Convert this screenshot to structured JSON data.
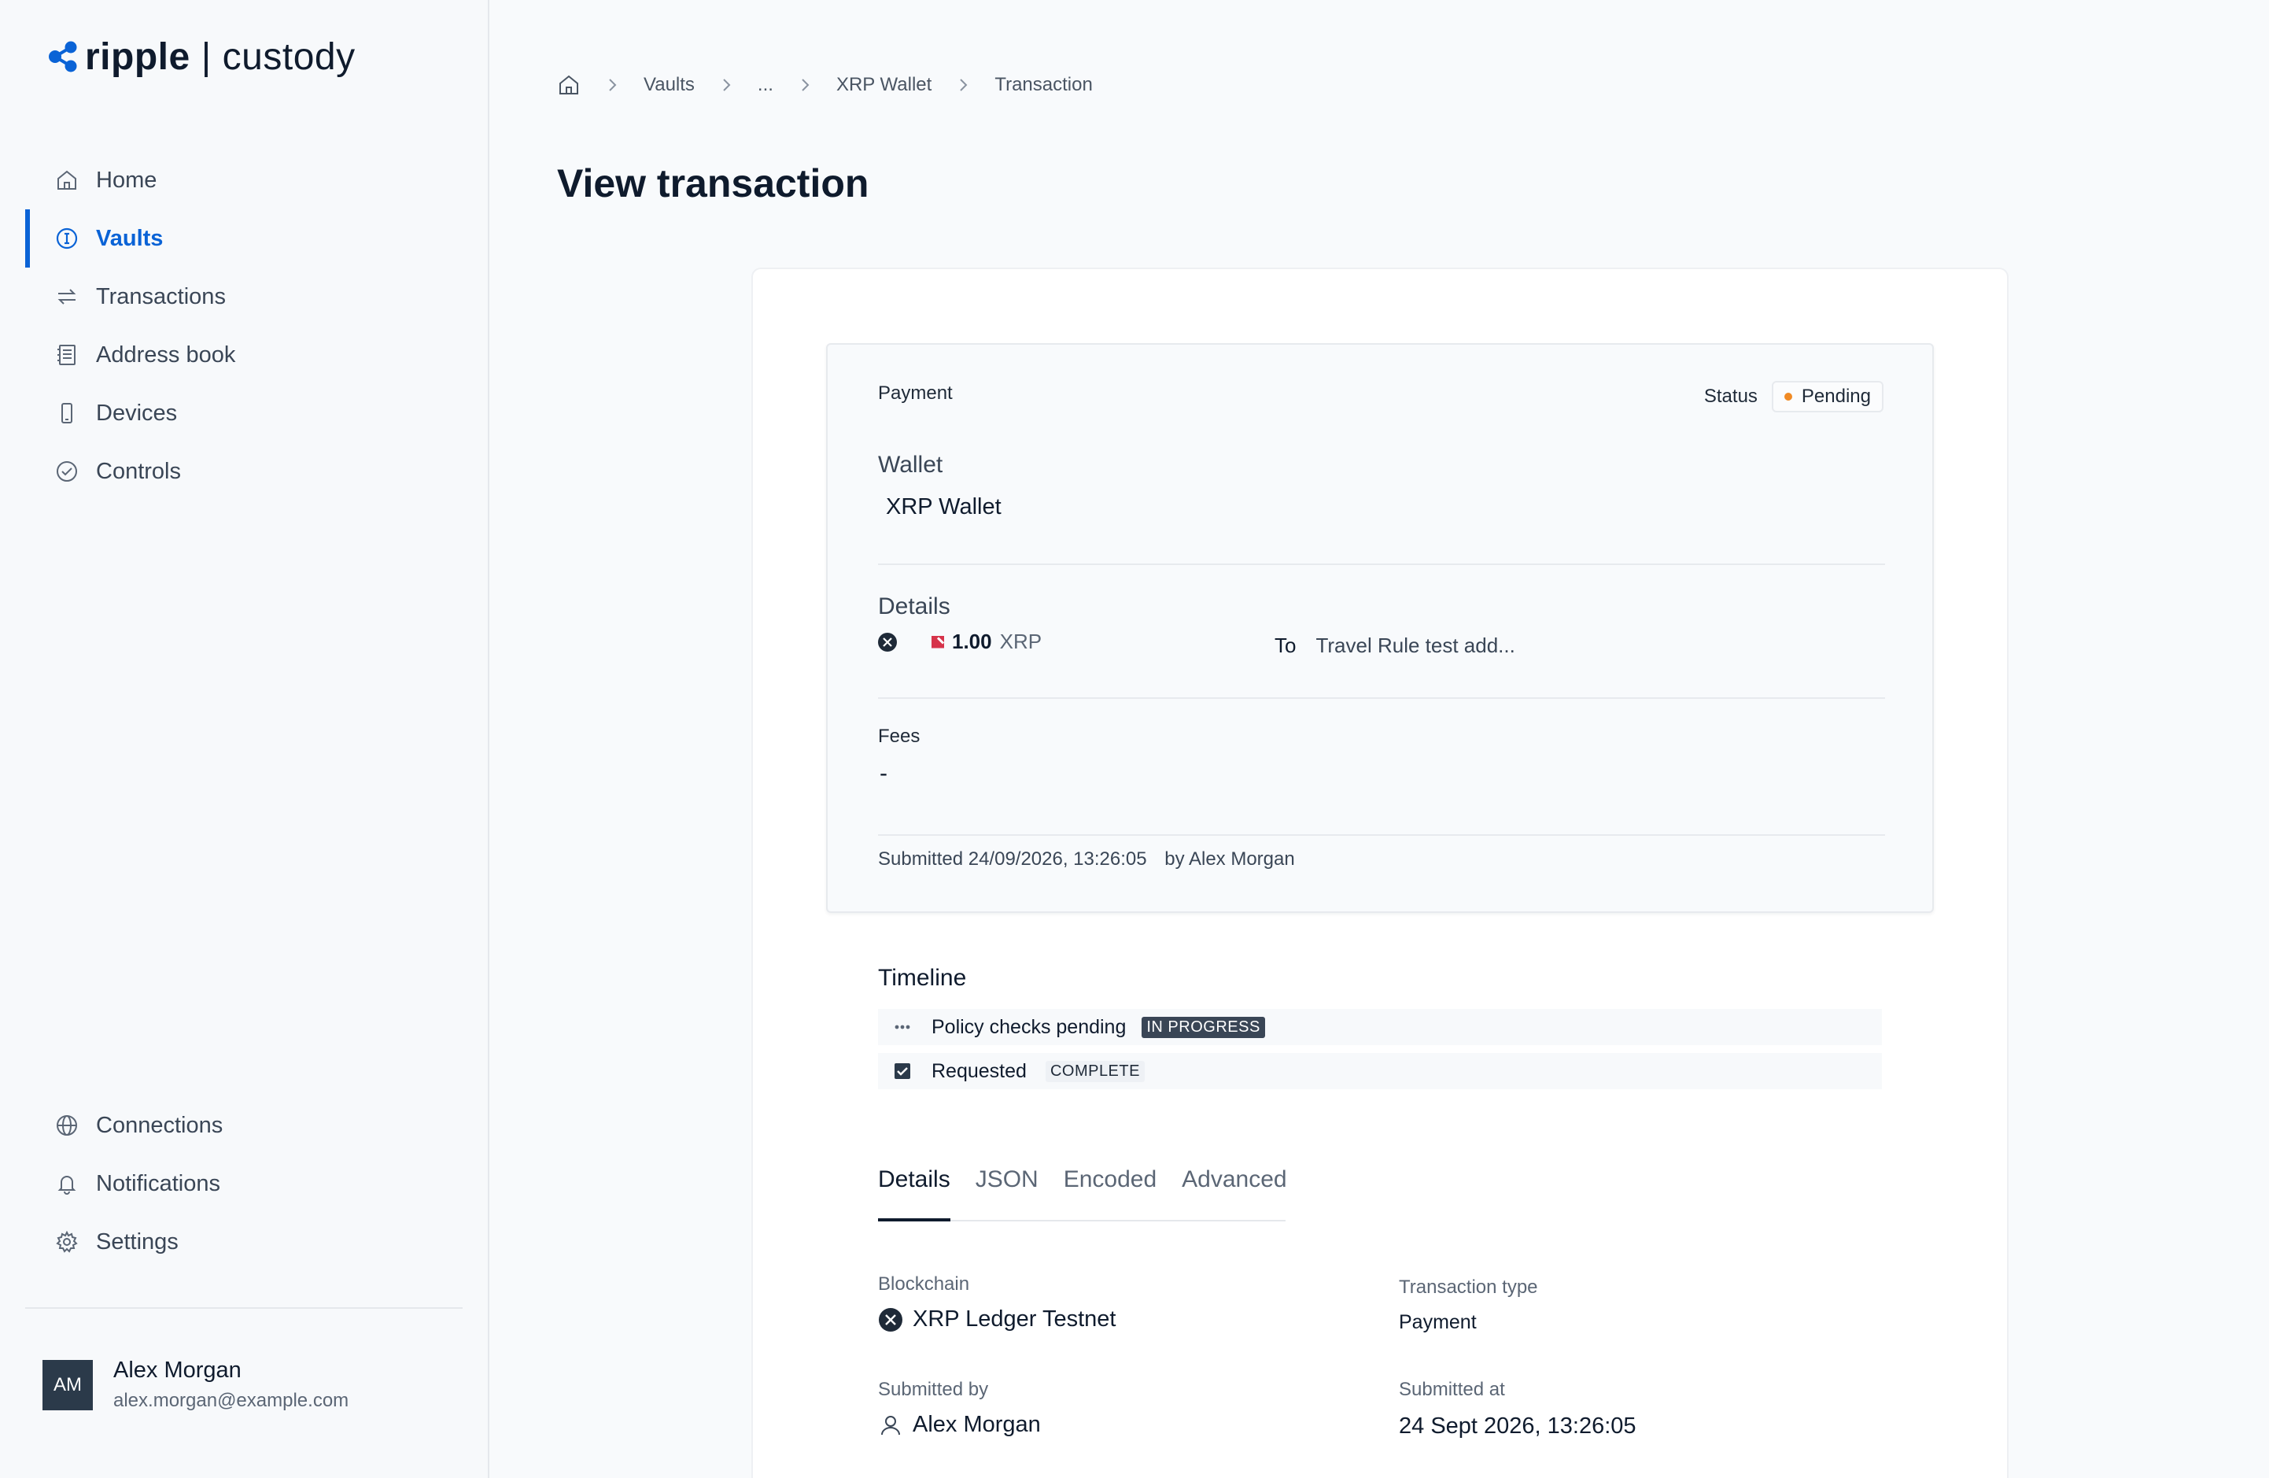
{
  "brand": {
    "name": "ripple",
    "separator": "|",
    "product": "custody"
  },
  "nav_main": [
    {
      "label": "Home",
      "icon": "home-icon"
    },
    {
      "label": "Vaults",
      "icon": "vault-icon",
      "active": true
    },
    {
      "label": "Transactions",
      "icon": "transactions-icon"
    },
    {
      "label": "Address book",
      "icon": "address-book-icon"
    },
    {
      "label": "Devices",
      "icon": "device-icon"
    },
    {
      "label": "Controls",
      "icon": "controls-icon"
    }
  ],
  "nav_secondary": [
    {
      "label": "Connections",
      "icon": "globe-icon"
    },
    {
      "label": "Notifications",
      "icon": "bell-icon"
    },
    {
      "label": "Settings",
      "icon": "gear-icon"
    }
  ],
  "user": {
    "initials": "AM",
    "name": "Alex Morgan",
    "email": "alex.morgan@example.com"
  },
  "breadcrumb": [
    "Vaults",
    "...",
    "XRP Wallet",
    "Transaction"
  ],
  "page_title": "View transaction",
  "summary": {
    "type": "Payment",
    "status_label": "Status",
    "status": "Pending",
    "wallet_label": "Wallet",
    "wallet": "XRP Wallet",
    "details_label": "Details",
    "amount": "1.00",
    "asset": "XRP",
    "to_label": "To",
    "to_value": "Travel Rule test add...",
    "fees_label": "Fees",
    "fees_value": "-",
    "submitted": "Submitted 24/09/2026, 13:26:05",
    "submitted_by": "by Alex Morgan"
  },
  "timeline": {
    "title": "Timeline",
    "items": [
      {
        "label": "Policy checks pending",
        "badge": "IN PROGRESS"
      },
      {
        "label": "Requested",
        "badge": "COMPLETE"
      }
    ]
  },
  "tabs": [
    "Details",
    "JSON",
    "Encoded",
    "Advanced"
  ],
  "details": {
    "blockchain_label": "Blockchain",
    "blockchain": "XRP Ledger Testnet",
    "tx_type_label": "Transaction type",
    "tx_type": "Payment",
    "submitted_by_label": "Submitted by",
    "submitted_by": "Alex Morgan",
    "submitted_at_label": "Submitted at",
    "submitted_at": "24 Sept 2026, 13:26:05"
  },
  "colors": {
    "accent": "#0a63d6",
    "pending": "#f08a24",
    "text": "#0f1b2d"
  }
}
